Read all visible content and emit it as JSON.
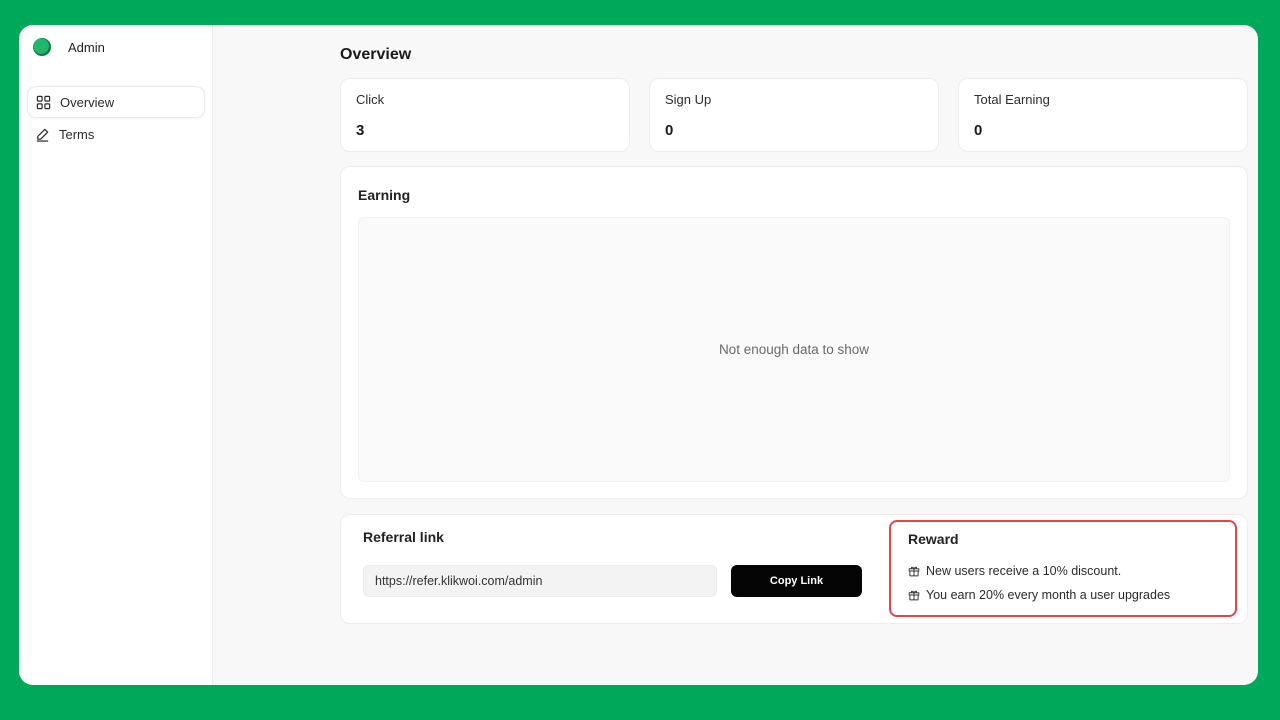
{
  "brand": {
    "name": "Admin",
    "logo_icon": "circle-logo-icon"
  },
  "sidebar": {
    "items": [
      {
        "label": "Overview",
        "icon": "grid-icon",
        "active": true
      },
      {
        "label": "Terms",
        "icon": "pencil-icon",
        "active": false
      }
    ]
  },
  "page": {
    "title": "Overview"
  },
  "stats": [
    {
      "label": "Click",
      "value": "3"
    },
    {
      "label": "Sign Up",
      "value": "0"
    },
    {
      "label": "Total Earning",
      "value": "0"
    }
  ],
  "earning": {
    "title": "Earning",
    "empty_message": "Not enough data to show"
  },
  "referral": {
    "title": "Referral link",
    "link_value": "https://refer.klikwoi.com/admin",
    "copy_button_label": "Copy Link"
  },
  "reward": {
    "title": "Reward",
    "lines": [
      "New users receive a 10% discount.",
      "You earn 20% every month a user upgrades"
    ],
    "line_icon": "gift-icon",
    "highlight_color": "#e04848"
  },
  "colors": {
    "background": "#00a85a",
    "accent": "#1fb86a",
    "button": "#050505"
  }
}
